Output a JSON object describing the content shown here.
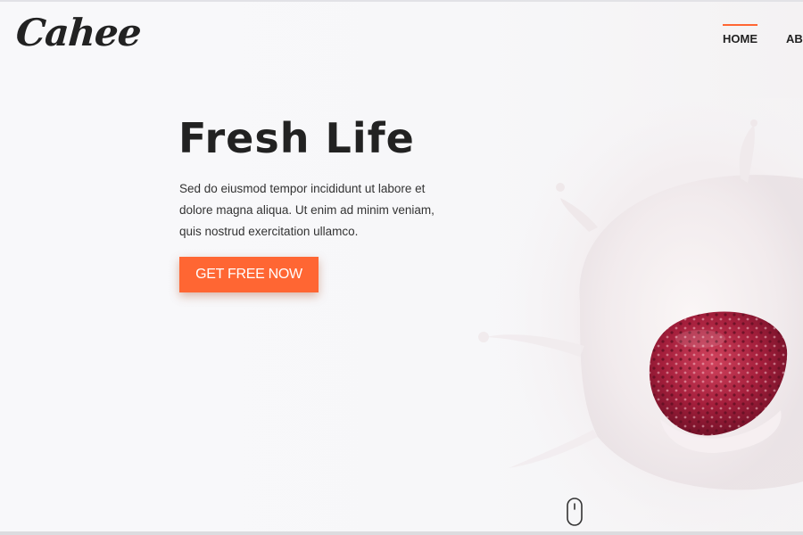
{
  "brand": {
    "logo_text": "Cahee"
  },
  "nav": {
    "items": [
      {
        "label": "HOME",
        "active": true
      },
      {
        "label": "ABOUT",
        "active": false
      }
    ]
  },
  "hero": {
    "title": "Fresh Life",
    "description": "Sed do eiusmod tempor incididunt ut labore et dolore magna aliqua. Ut enim ad minim veniam, quis nostrud exercitation ullamco.",
    "cta_label": "GET FREE NOW",
    "image_icon": "strawberry-milk-splash"
  },
  "colors": {
    "accent": "#ff6633",
    "text": "#222222",
    "background": "#f7f7f9"
  }
}
